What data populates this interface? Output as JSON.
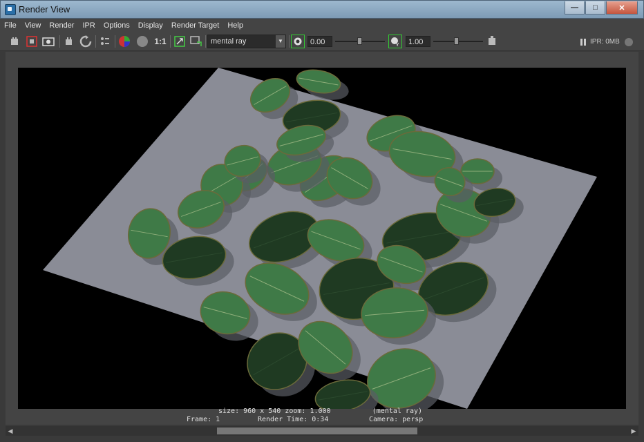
{
  "window": {
    "title": "Render View",
    "buttons": [
      "—",
      "□",
      "✕"
    ]
  },
  "menu": [
    "File",
    "View",
    "Render",
    "IPR",
    "Options",
    "Display",
    "Render Target",
    "Help"
  ],
  "toolbar": {
    "renderer": "mental ray",
    "exposure_value": "0.00",
    "gamma_value": "1.00",
    "one_to_one": "1:1",
    "ipr_memory": "IPR: 0MB"
  },
  "status": {
    "line1": "size: 960 x 540 zoom: 1.000          (mental ray)",
    "frame": "Frame: 1",
    "render_time": "Render Time: 0:34",
    "camera": "Camera: persp"
  },
  "colors": {
    "viewport_bg": "#000000",
    "ground_plane": "#8a8c96",
    "leaf": "#3f7a47",
    "leaf_dark": "#1f3a22"
  },
  "icons": [
    "redo-render-icon",
    "render-region-icon",
    "snapshot-icon",
    "ipr-render-icon",
    "refresh-icon",
    "render-settings-icon",
    "rgb-channel-icon",
    "alpha-channel-icon",
    "keep-image-icon",
    "remove-image-icon",
    "exposure-icon",
    "gamma-icon",
    "color-management-icon",
    "pause-icon"
  ]
}
